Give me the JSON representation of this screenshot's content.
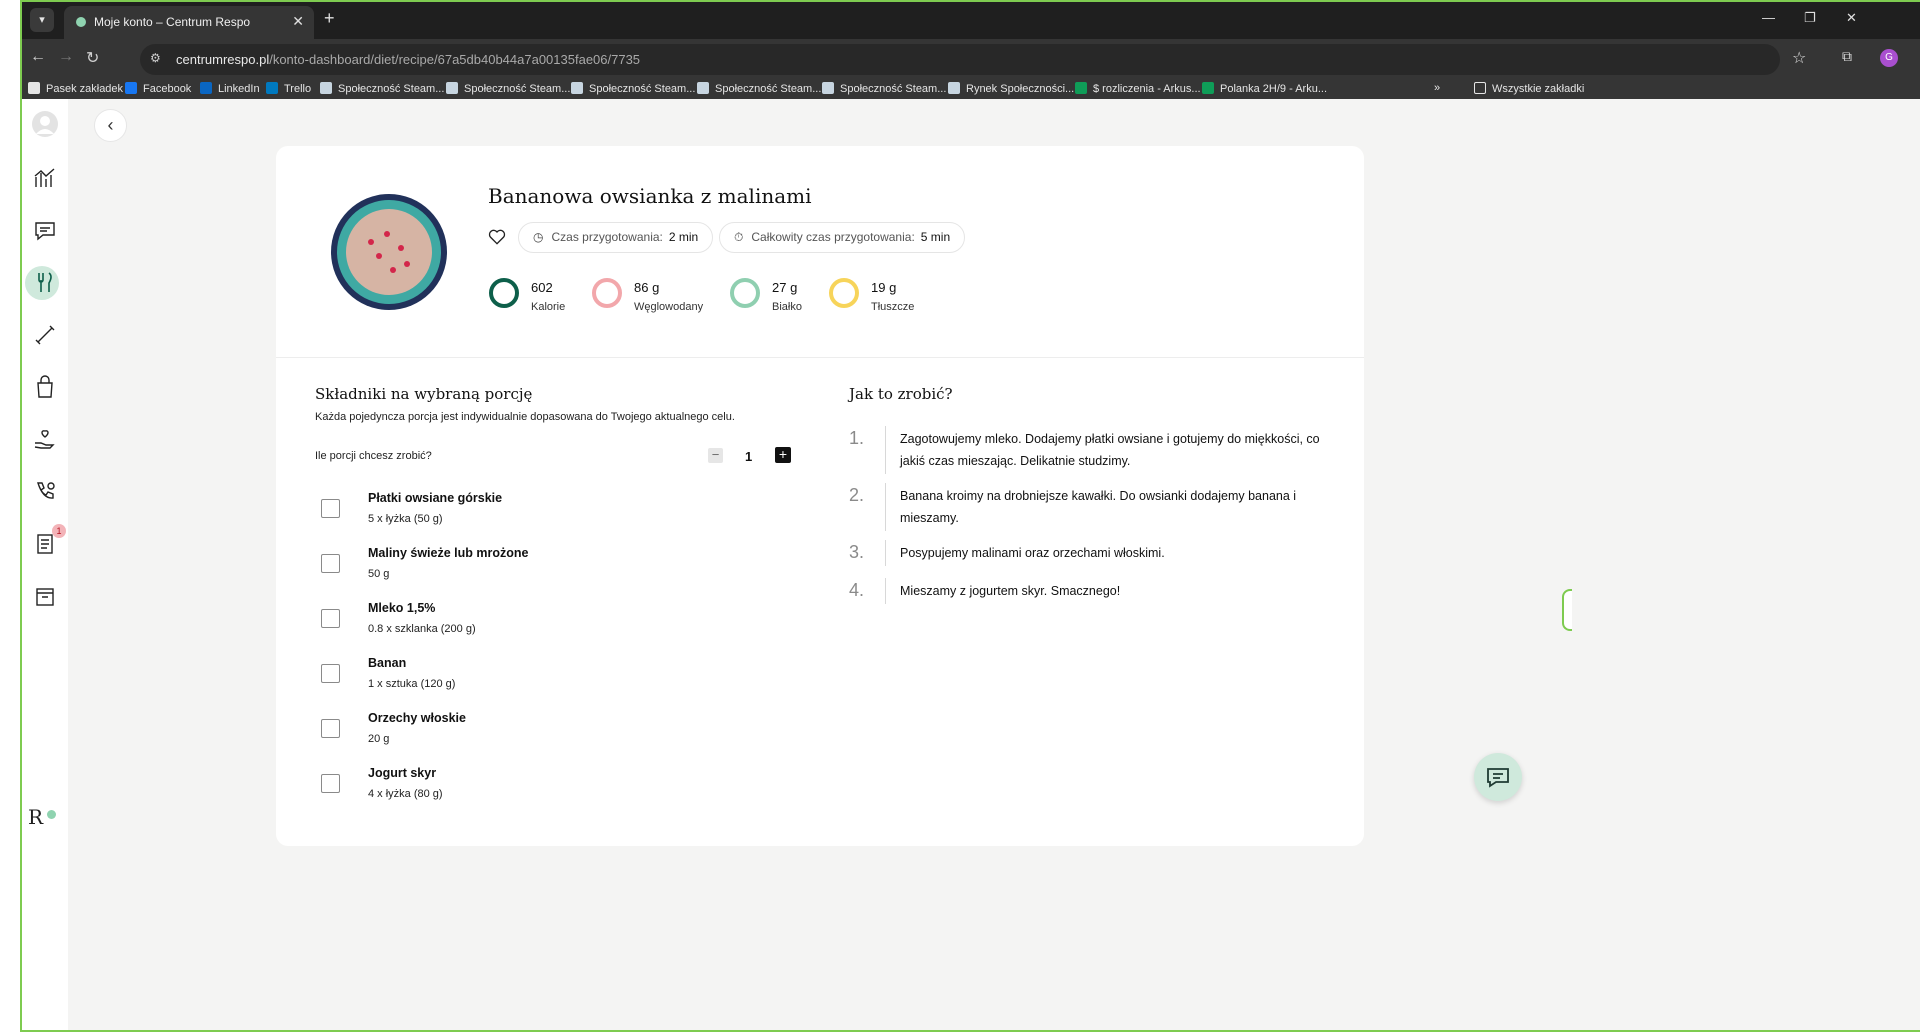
{
  "browser": {
    "tab_title": "Moje konto – Centrum Respo",
    "url_host": "centrumrespo.pl",
    "url_path": "/konto-dashboard/diet/recipe/67a5db40b44a7a00135fae06/7735",
    "profile_initial": "G",
    "bookmarks": [
      {
        "label": "Pasek zakładek",
        "icon": "folder-icon",
        "color": "#e5e5e5"
      },
      {
        "label": "Facebook",
        "icon": "facebook-icon",
        "color": "#1877f2"
      },
      {
        "label": "LinkedIn",
        "icon": "linkedin-icon",
        "color": "#0a66c2"
      },
      {
        "label": "Trello",
        "icon": "trello-icon",
        "color": "#0079bf"
      },
      {
        "label": "Społeczność Steam...",
        "icon": "steam-icon",
        "color": "#c7d5e0"
      },
      {
        "label": "Społeczność Steam...",
        "icon": "steam-icon",
        "color": "#c7d5e0"
      },
      {
        "label": "Społeczność Steam...",
        "icon": "steam-icon",
        "color": "#c7d5e0"
      },
      {
        "label": "Społeczność Steam...",
        "icon": "steam-icon",
        "color": "#c7d5e0"
      },
      {
        "label": "Społeczność Steam...",
        "icon": "steam-icon",
        "color": "#c7d5e0"
      },
      {
        "label": "Rynek Społeczności...",
        "icon": "steam-icon",
        "color": "#c7d5e0"
      },
      {
        "label": "$ rozliczenia - Arkus...",
        "icon": "sheets-icon",
        "color": "#0f9d58"
      },
      {
        "label": "Polanka 2H/9 - Arku...",
        "icon": "sheets-icon",
        "color": "#0f9d58"
      }
    ],
    "all_bookmarks": "Wszystkie zakładki"
  },
  "sidebar": {
    "badge_count": "1",
    "logo": "R"
  },
  "recipe": {
    "title": "Bananowa owsianka z malinami",
    "prep_label": "Czas przygotowania:",
    "prep_value": "2 min",
    "total_label": "Całkowity czas przygotowania:",
    "total_value": "5 min",
    "macros": [
      {
        "value": "602",
        "label": "Kalorie",
        "color": "#0d5f4a"
      },
      {
        "value": "86 g",
        "label": "Węglowodany",
        "color": "#f2a7ab"
      },
      {
        "value": "27 g",
        "label": "Białko",
        "color": "#8fcfb0"
      },
      {
        "value": "19 g",
        "label": "Tłuszcze",
        "color": "#f7d45a"
      }
    ]
  },
  "ingredients": {
    "title": "Składniki na wybraną porcję",
    "subtitle": "Każda pojedyncza porcja jest indywidualnie dopasowana do Twojego aktualnego celu.",
    "portions_question": "Ile porcji chcesz zrobić?",
    "portions_count": "1",
    "minus": "−",
    "plus": "+",
    "items": [
      {
        "name": "Płatki owsiane górskie",
        "qty": "5 x łyżka (50 g)"
      },
      {
        "name": "Maliny świeże lub mrożone",
        "qty": "50 g"
      },
      {
        "name": "Mleko 1,5%",
        "qty": "0.8 x szklanka (200 g)"
      },
      {
        "name": "Banan",
        "qty": "1 x sztuka (120 g)"
      },
      {
        "name": "Orzechy włoskie",
        "qty": "20 g"
      },
      {
        "name": "Jogurt skyr",
        "qty": "4 x łyżka (80 g)"
      }
    ]
  },
  "steps": {
    "title": "Jak to zrobić?",
    "items": [
      {
        "num": "1.",
        "text": "Zagotowujemy mleko. Dodajemy płatki owsiane i gotujemy do miękkości, co jakiś czas mieszając. Delikatnie studzimy."
      },
      {
        "num": "2.",
        "text": "Banana kroimy na drobniejsze kawałki. Do owsianki dodajemy banana i mieszamy."
      },
      {
        "num": "3.",
        "text": "Posypujemy malinami oraz orzechami włoskimi."
      },
      {
        "num": "4.",
        "text": "Mieszamy z jogurtem skyr. Smacznego!"
      }
    ]
  }
}
